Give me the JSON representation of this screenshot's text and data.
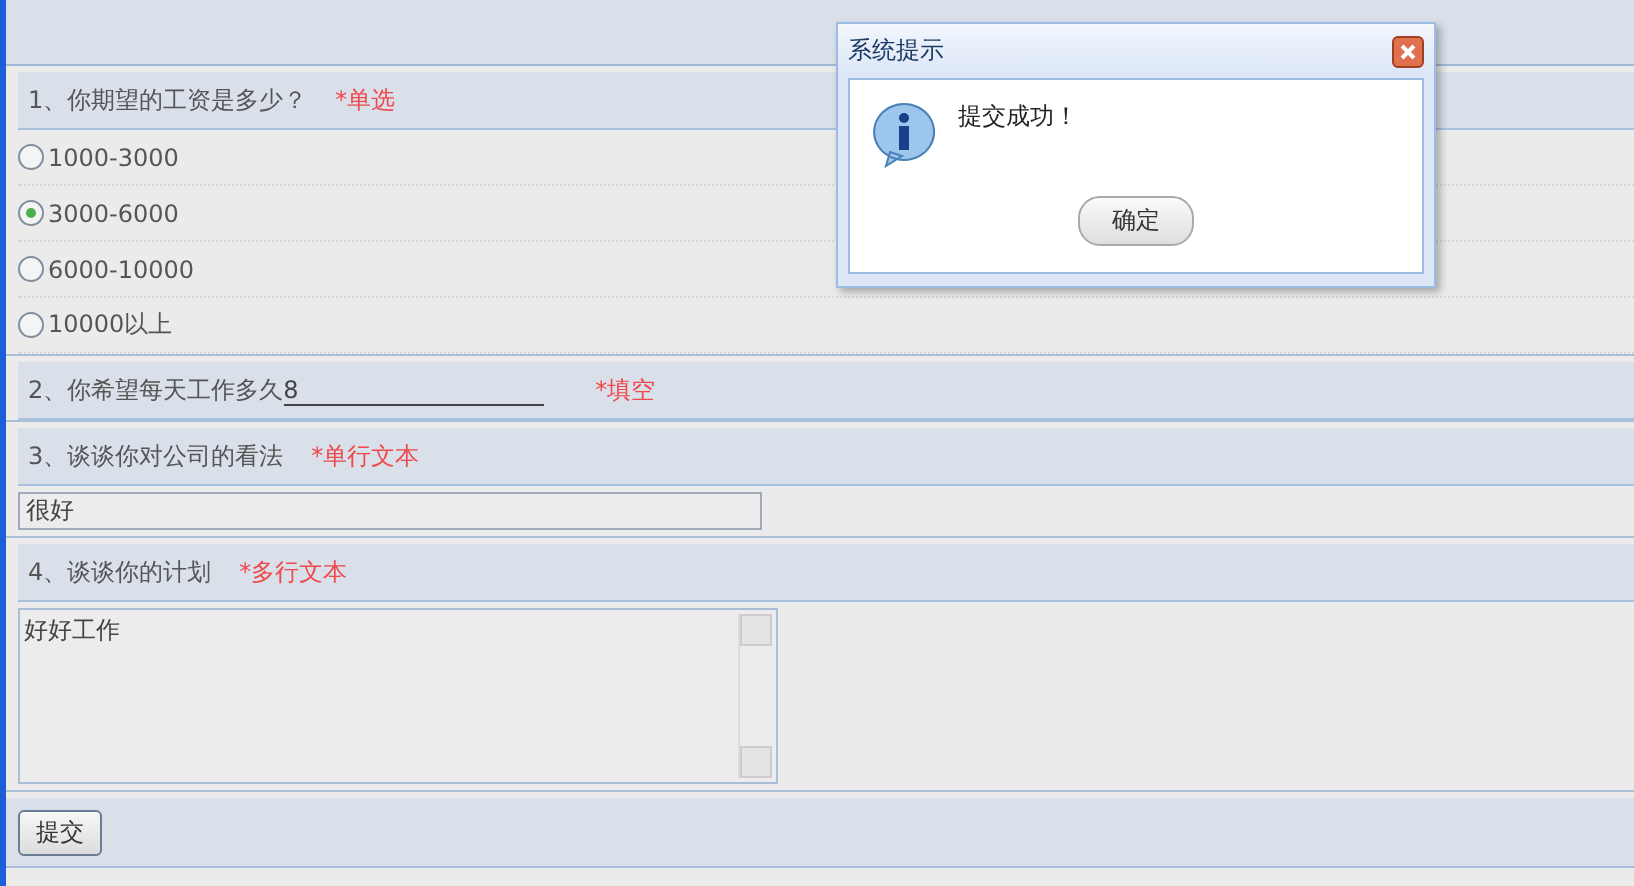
{
  "questions": [
    {
      "kind": "radio",
      "title": "1、你期望的工资是多少？",
      "tag": "*单选",
      "options": [
        {
          "label": "1000-3000",
          "selected": false
        },
        {
          "label": "3000-6000",
          "selected": true
        },
        {
          "label": "6000-10000",
          "selected": false
        },
        {
          "label": "10000以上",
          "selected": false
        }
      ]
    },
    {
      "kind": "blank",
      "title": "2、你希望每天工作多久",
      "value": "8",
      "tag": "*填空"
    },
    {
      "kind": "text",
      "title": "3、谈谈你对公司的看法",
      "tag": "*单行文本",
      "value": "很好"
    },
    {
      "kind": "textarea",
      "title": "4、谈谈你的计划",
      "tag": "*多行文本",
      "value": "好好工作"
    }
  ],
  "submit": "提交",
  "dialog": {
    "title": "系统提示",
    "message": "提交成功！",
    "button": "确定"
  }
}
